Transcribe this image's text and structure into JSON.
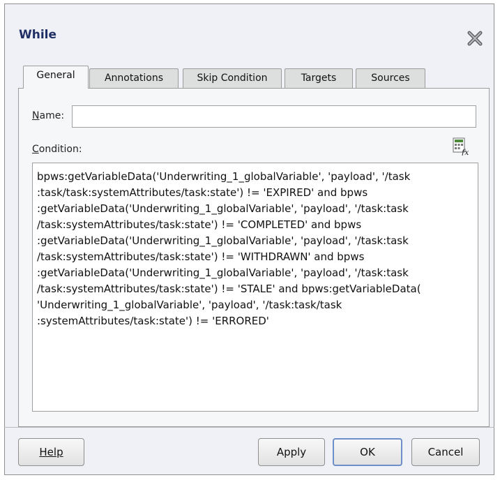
{
  "dialog": {
    "title": "While",
    "close_icon": "close-x-icon"
  },
  "tabs": [
    {
      "label": "General",
      "active": true
    },
    {
      "label": "Annotations",
      "active": false
    },
    {
      "label": "Skip Condition",
      "active": false
    },
    {
      "label": "Targets",
      "active": false
    },
    {
      "label": "Sources",
      "active": false
    }
  ],
  "form": {
    "name_label": "Name:",
    "name_value": "",
    "condition_label": "Condition:",
    "expression_builder_icon": "expression-builder-icon",
    "condition_value": "bpws:getVariableData('Underwriting_1_globalVariable', 'payload', '/task\n:task/task:systemAttributes/task:state') != 'EXPIRED' and bpws\n:getVariableData('Underwriting_1_globalVariable', 'payload', '/task:task\n/task:systemAttributes/task:state') != 'COMPLETED' and bpws\n:getVariableData('Underwriting_1_globalVariable', 'payload', '/task:task\n/task:systemAttributes/task:state') != 'WITHDRAWN' and bpws\n:getVariableData('Underwriting_1_globalVariable', 'payload', '/task:task\n/task:systemAttributes/task:state') != 'STALE' and bpws:getVariableData(\n'Underwriting_1_globalVariable', 'payload', '/task:task/task\n:systemAttributes/task:state') != 'ERRORED'"
  },
  "buttons": {
    "help": "Help",
    "apply": "Apply",
    "ok": "OK",
    "cancel": "Cancel"
  }
}
